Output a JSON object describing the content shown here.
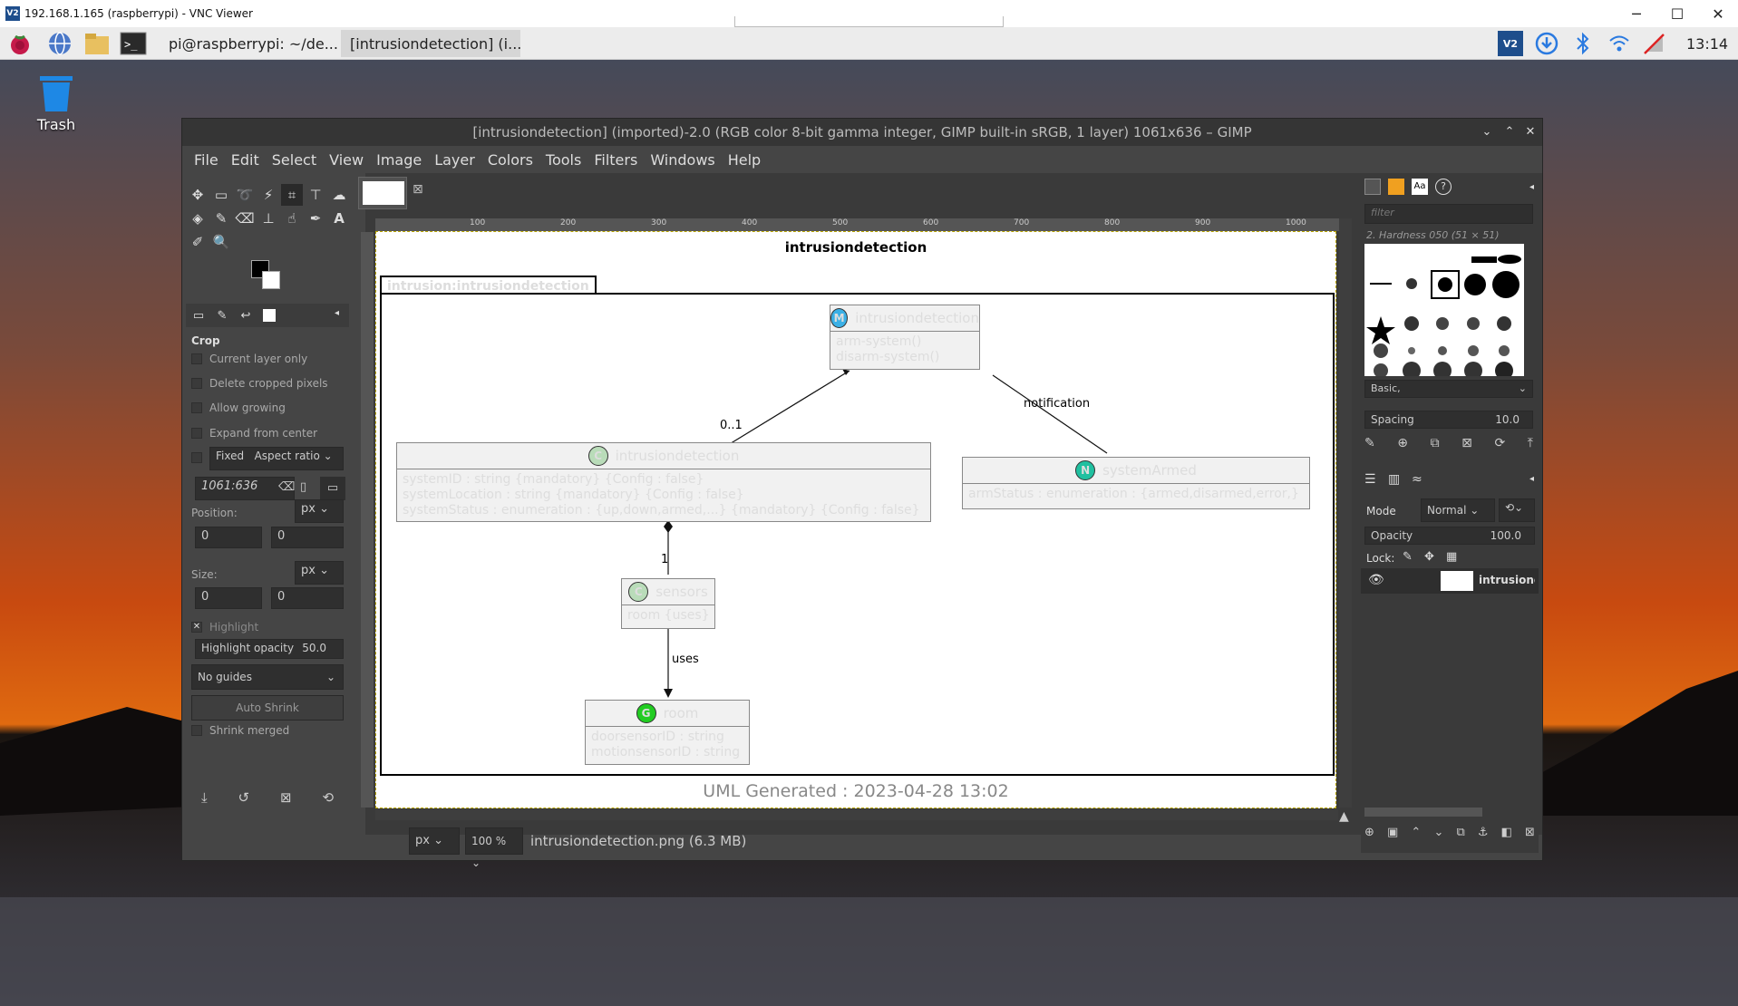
{
  "vnc": {
    "title": "192.168.1.165 (raspberrypi) - VNC Viewer",
    "logo": "V2"
  },
  "taskbar": {
    "terminal_task": "pi@raspberrypi: ~/de...",
    "gimp_task": "[intrusiondetection] (i...",
    "clock": "13:14"
  },
  "desktop": {
    "trash_label": "Trash"
  },
  "gimp": {
    "title": "[intrusiondetection] (imported)-2.0 (RGB color 8-bit gamma integer, GIMP built-in sRGB, 1 layer) 1061x636 – GIMP",
    "menu": [
      "File",
      "Edit",
      "Select",
      "View",
      "Image",
      "Layer",
      "Colors",
      "Tools",
      "Filters",
      "Windows",
      "Help"
    ],
    "tool_options": {
      "title": "Crop",
      "current_layer_only": "Current layer only",
      "delete_cropped": "Delete cropped pixels",
      "allow_growing": "Allow growing",
      "expand_center": "Expand from center",
      "fixed": "Fixed",
      "aspect_ratio": "Aspect ratio",
      "ratio_value": "1061:636",
      "position_label": "Position:",
      "size_label": "Size:",
      "unit": "px",
      "pos_x": "0",
      "pos_y": "0",
      "size_w": "0",
      "size_h": "0",
      "highlight": "Highlight",
      "highlight_opacity_label": "Highlight opacity",
      "highlight_opacity_value": "50.0",
      "guides": "No guides",
      "auto_shrink": "Auto Shrink",
      "shrink_merged": "Shrink merged"
    },
    "ruler_ticks": [
      "100",
      "200",
      "300",
      "400",
      "500",
      "600",
      "700",
      "800",
      "900",
      "1000"
    ],
    "status": {
      "unit": "px",
      "zoom": "100 %",
      "file": "intrusiondetection.png (6.3 MB)"
    },
    "brushes": {
      "filter_placeholder": "filter",
      "current": "2. Hardness 050 (51 × 51)",
      "preset": "Basic,",
      "spacing_label": "Spacing",
      "spacing_value": "10.0"
    },
    "layers": {
      "mode_label": "Mode",
      "mode_value": "Normal",
      "opacity_label": "Opacity",
      "opacity_value": "100.0",
      "lock_label": "Lock:",
      "layer_name": "intrusiondetection"
    }
  },
  "diagram": {
    "title": "intrusiondetection",
    "package": "intrusion:intrusiondetection",
    "footer": "UML Generated : 2023-04-28 13:02",
    "module": {
      "badge": "M",
      "name": "intrusiondetection",
      "members": [
        "arm-system()",
        "disarm-system()"
      ]
    },
    "container": {
      "badge": "C",
      "name": "intrusiondetection",
      "members": [
        "systemID : string  {mandatory} {Config : false}",
        "systemLocation : string  {mandatory} {Config : false}",
        "systemStatus : enumeration : {up,down,armed,...}  {mandatory} {Config : false}"
      ]
    },
    "notification": {
      "badge": "N",
      "name": "systemArmed",
      "members": [
        "armStatus : enumeration : {armed,disarmed,error,}"
      ]
    },
    "sensors": {
      "badge": "C",
      "name": "sensors",
      "members": [
        "room {uses}"
      ]
    },
    "room": {
      "badge": "G",
      "name": "room",
      "members": [
        "doorsensorID : string",
        "motionsensorID : string"
      ]
    },
    "labels": {
      "mult_01": "0..1",
      "notification": "notification",
      "mult_1": "1",
      "uses": "uses"
    }
  },
  "colors": {
    "module_badge": "#3bb0e6",
    "container_badge": "#b9dcb9",
    "notification_badge": "#20c0a0",
    "grouping_badge": "#22cc22"
  }
}
